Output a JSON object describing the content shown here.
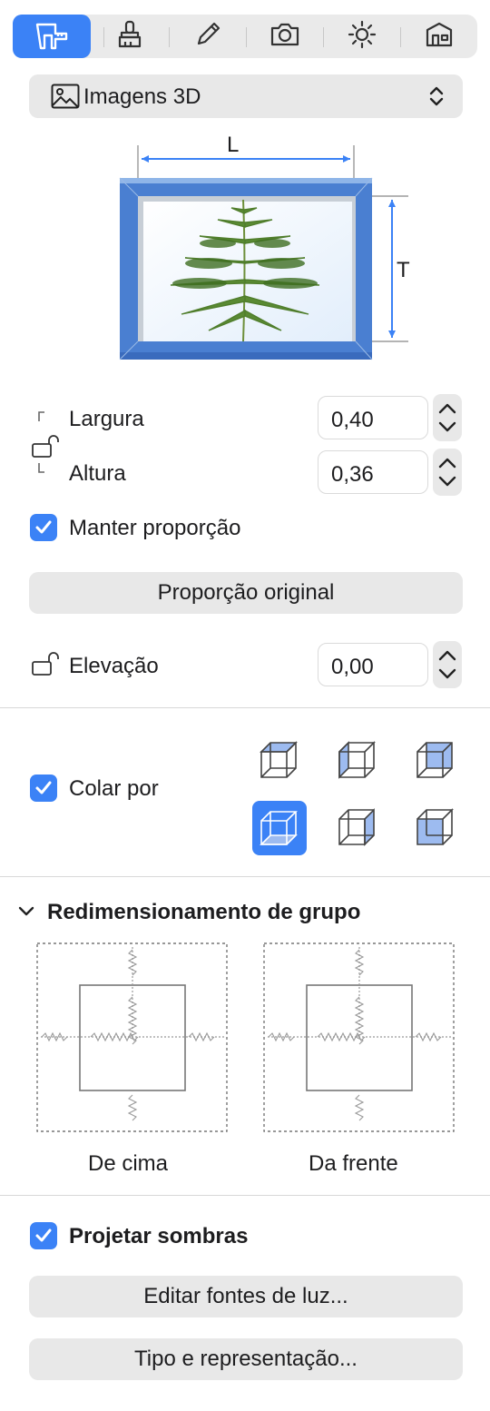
{
  "toolbar": {
    "tabs": [
      {
        "icon": "tape-measure-icon",
        "active": true
      },
      {
        "icon": "brush-icon",
        "active": false
      },
      {
        "icon": "pencil-icon",
        "active": false
      },
      {
        "icon": "camera-icon",
        "active": false
      },
      {
        "icon": "sun-icon",
        "active": false
      },
      {
        "icon": "house-icon",
        "active": false
      }
    ]
  },
  "type_select": {
    "label": "Imagens 3D",
    "icon": "image-icon"
  },
  "preview": {
    "width_marker": "L",
    "height_marker": "T"
  },
  "dimensions": {
    "width_label": "Largura",
    "width_value": "0,40",
    "height_label": "Altura",
    "height_value": "0,36",
    "keep_ratio_label": "Manter proporção",
    "keep_ratio_checked": true,
    "original_ratio_button": "Proporção original",
    "elevation_label": "Elevação",
    "elevation_value": "0,00"
  },
  "stick": {
    "label": "Colar por",
    "checked": true,
    "selected_index": 3
  },
  "group_resize": {
    "title": "Redimensionamento de grupo",
    "top_label": "De cima",
    "front_label": "Da frente"
  },
  "shadows": {
    "label": "Projetar sombras",
    "checked": true,
    "edit_lights_button": "Editar fontes de luz...",
    "type_button": "Tipo e representação..."
  },
  "colors": {
    "accent": "#3b82f6",
    "frame": "#4a7fd1"
  }
}
